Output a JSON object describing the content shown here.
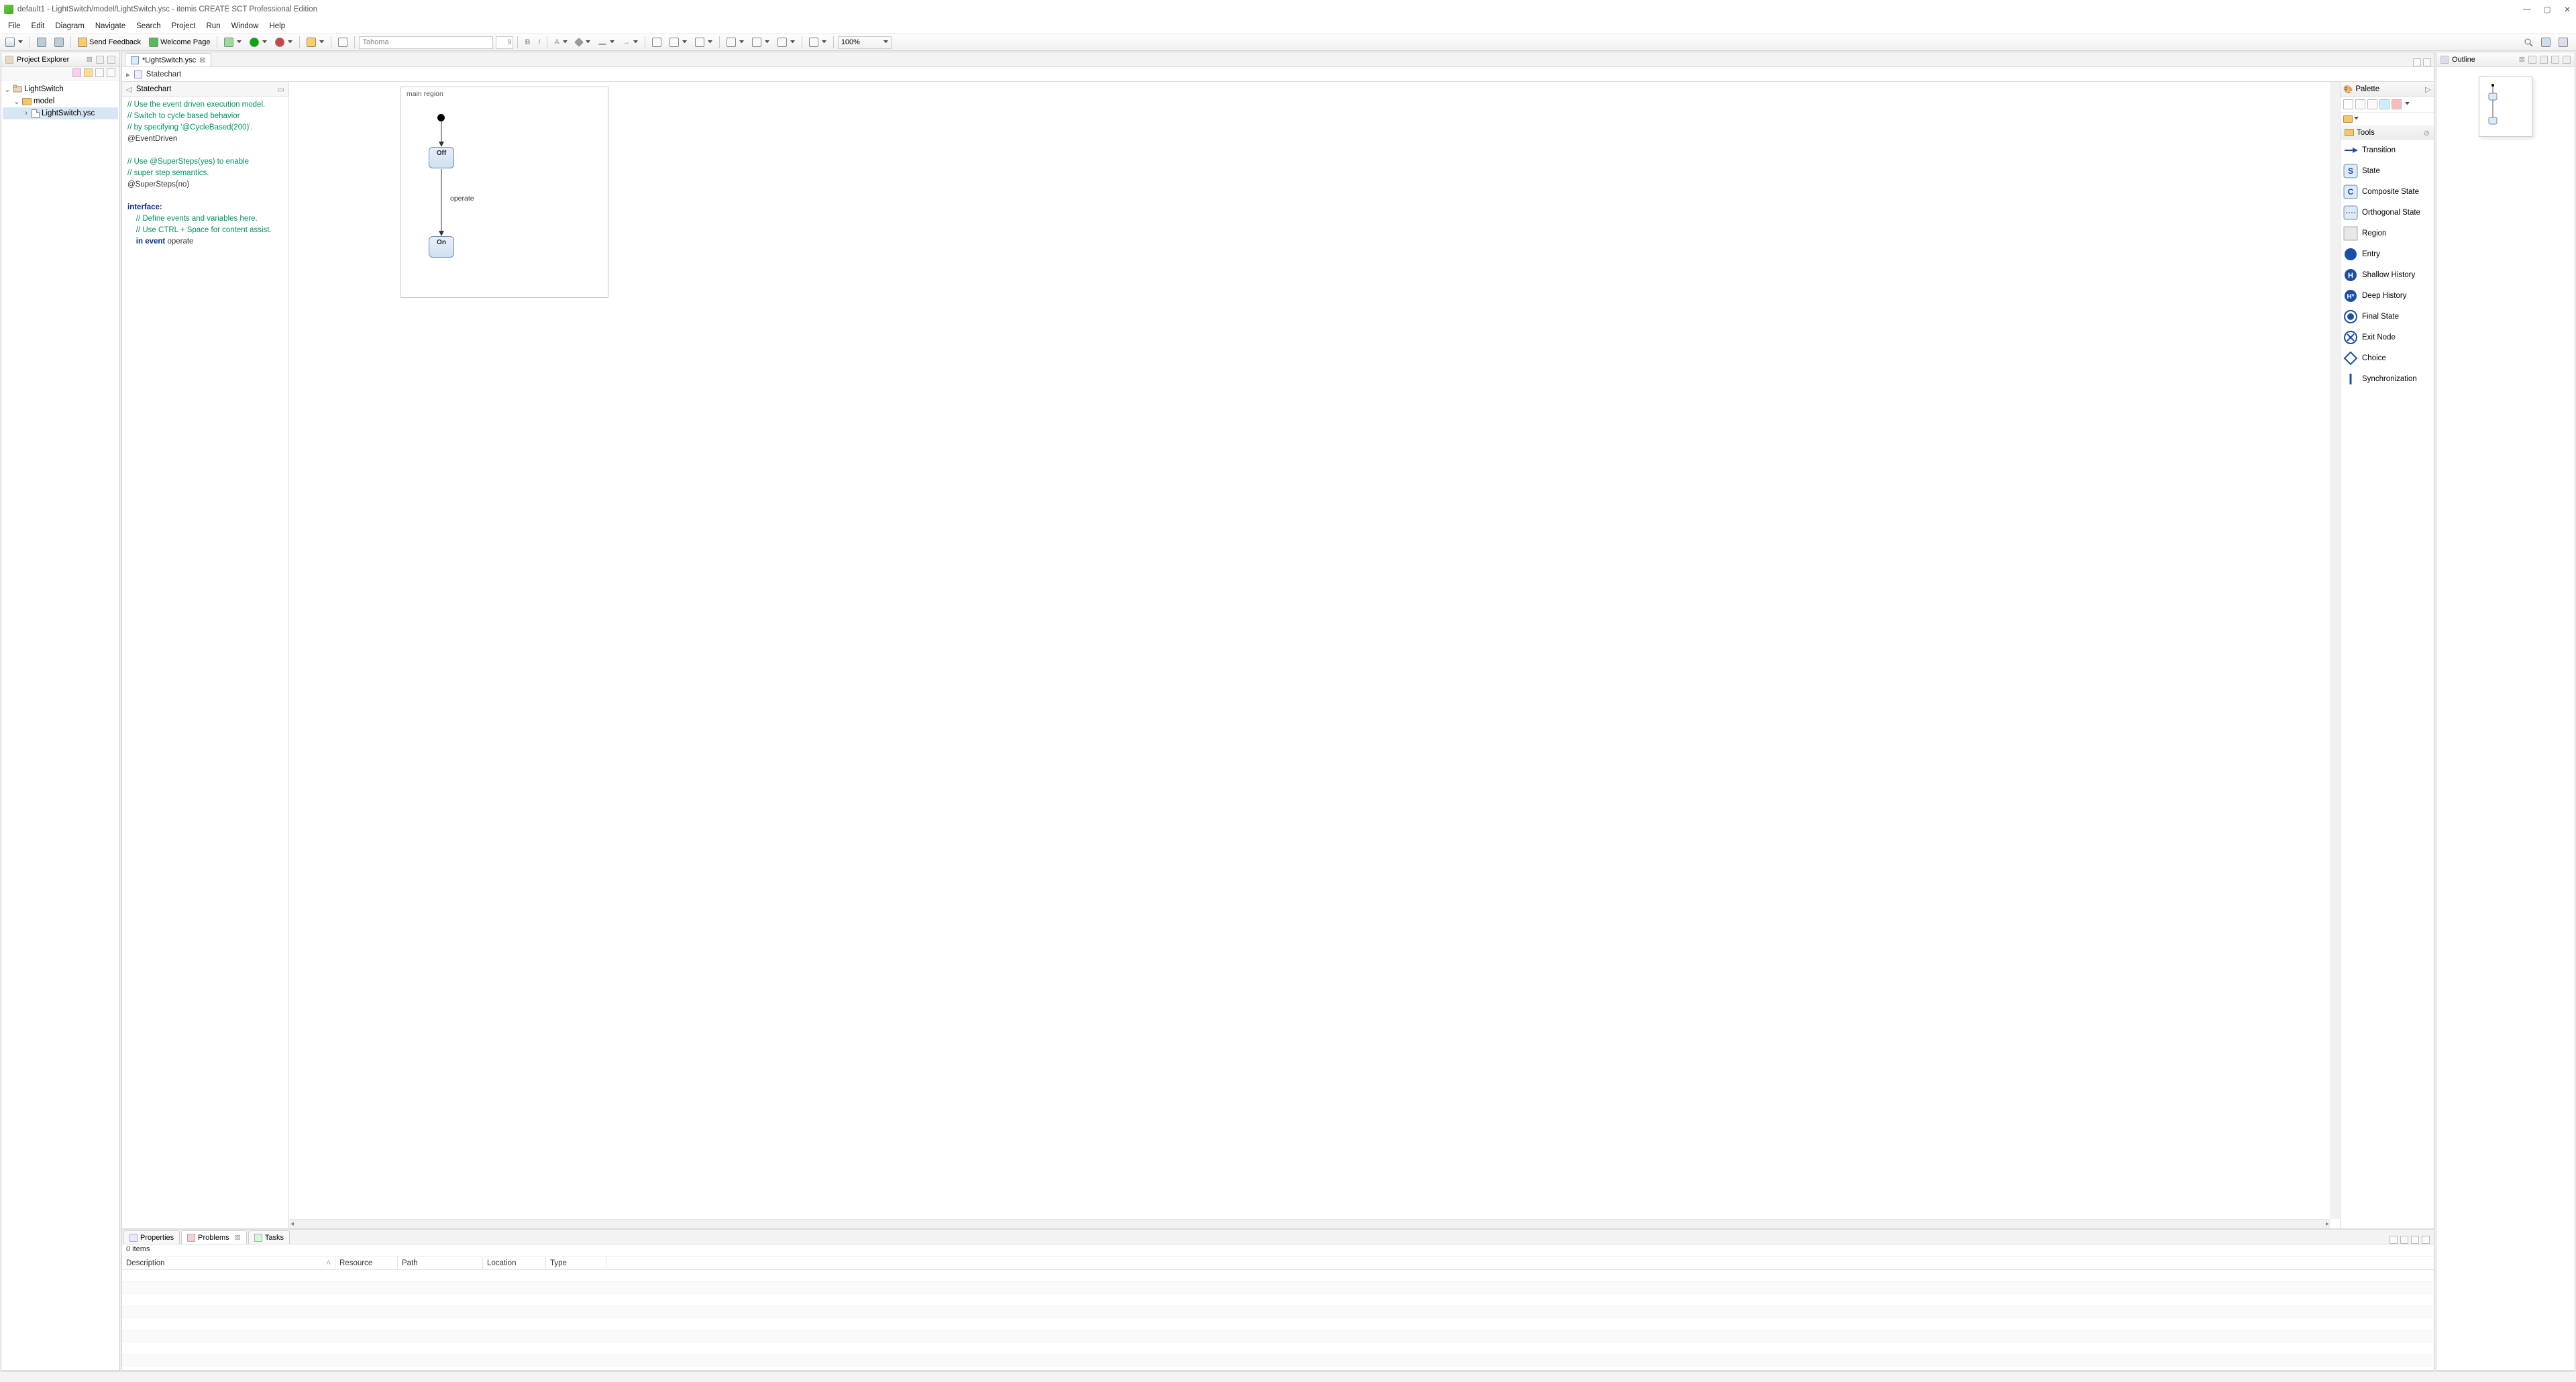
{
  "window": {
    "title": "default1 - LightSwitch/model/LightSwitch.ysc - itemis CREATE SCT Professional Edition"
  },
  "menu": [
    "File",
    "Edit",
    "Diagram",
    "Navigate",
    "Search",
    "Project",
    "Run",
    "Window",
    "Help"
  ],
  "toolbar": {
    "send_feedback": "Send Feedback",
    "welcome_page": "Welcome Page",
    "font_name": "Tahoma",
    "font_size": "9",
    "zoom": "100%"
  },
  "project_explorer": {
    "title": "Project Explorer",
    "tree": {
      "root": "LightSwitch",
      "folder": "model",
      "file": "LightSwitch.ysc"
    }
  },
  "editor": {
    "tab": "*LightSwitch.ysc",
    "breadcrumb": "Statechart",
    "definition": {
      "title": "Statechart",
      "lines": [
        {
          "cls": "c-comment",
          "text": "// Use the event driven execution model."
        },
        {
          "cls": "c-comment",
          "text": "// Switch to cycle based behavior"
        },
        {
          "cls": "c-comment",
          "text": "// by specifying '@CycleBased(200)'."
        },
        {
          "cls": "c-ann",
          "text": "@EventDriven"
        },
        {
          "cls": "",
          "text": ""
        },
        {
          "cls": "c-comment",
          "text": "// Use @SuperSteps(yes) to enable"
        },
        {
          "cls": "c-comment",
          "text": "// super step semantics."
        },
        {
          "cls": "c-ann",
          "text": "@SuperSteps(no)"
        },
        {
          "cls": "",
          "text": ""
        },
        {
          "cls": "c-kw",
          "text": "interface:"
        },
        {
          "cls": "c-comment",
          "text": "    // Define events and variables here."
        },
        {
          "cls": "c-comment",
          "text": "    // Use CTRL + Space for content assist."
        }
      ],
      "in_event_kw": "in event",
      "in_event_name": " operate"
    },
    "diagram": {
      "region_label": "main region",
      "state_off": "Off",
      "state_on": "On",
      "transition_label": "operate"
    }
  },
  "palette": {
    "title": "Palette",
    "section": "Tools",
    "items": [
      "Transition",
      "State",
      "Composite State",
      "Orthogonal State",
      "Region",
      "Entry",
      "Shallow History",
      "Deep History",
      "Final State",
      "Exit Node",
      "Choice",
      "Synchronization"
    ]
  },
  "bottom": {
    "tabs": [
      "Properties",
      "Problems",
      "Tasks"
    ],
    "items_count": "0 items",
    "columns": [
      "Description",
      "Resource",
      "Path",
      "Location",
      "Type"
    ]
  },
  "outline": {
    "title": "Outline"
  }
}
